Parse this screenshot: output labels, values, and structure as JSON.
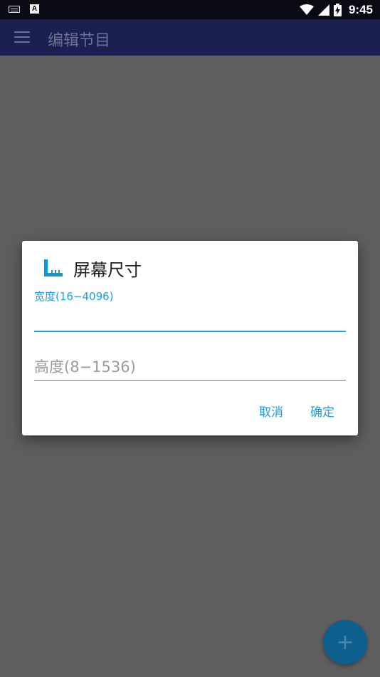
{
  "status_bar": {
    "time": "9:45",
    "icons": [
      "keyboard-icon",
      "a-notification-icon",
      "wifi-icon",
      "signal-icon",
      "battery-charging-icon"
    ]
  },
  "app_bar": {
    "title": "编辑节目",
    "menu_icon": "menu-icon"
  },
  "dialog": {
    "title": "屏幕尺寸",
    "icon": "screen-size-logo-icon",
    "width_field": {
      "label": "宽度(16−4096)",
      "value": ""
    },
    "height_field": {
      "placeholder": "高度(8−1536)",
      "value": ""
    },
    "cancel_label": "取消",
    "ok_label": "确定"
  },
  "fab": {
    "icon": "plus-icon",
    "glyph": "+"
  },
  "colors": {
    "accent": "#1ba2dd",
    "app_bar": "#1a2152",
    "scrim": "#5f5f5f",
    "fab": "#0e5f8e"
  }
}
